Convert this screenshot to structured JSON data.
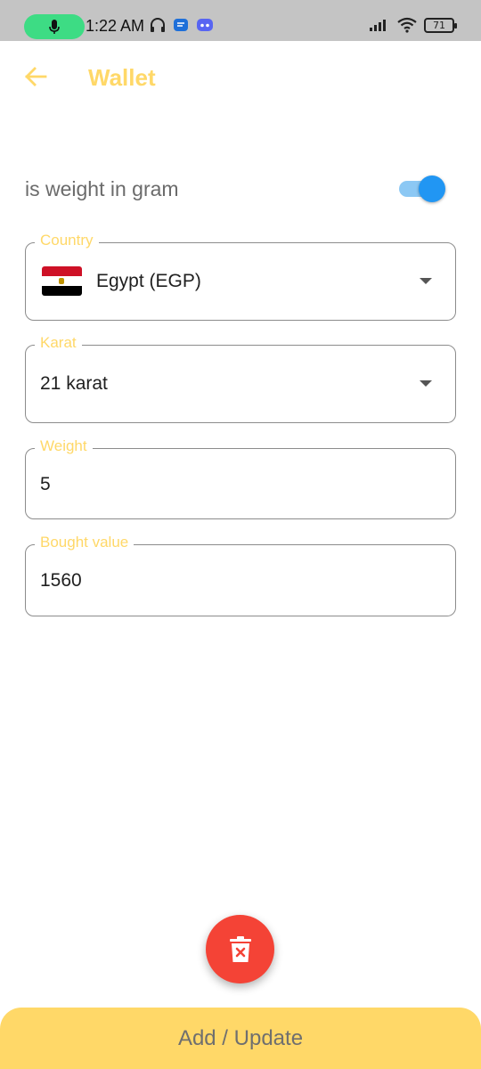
{
  "status_bar": {
    "time": "1:22 AM",
    "battery": "71",
    "icons_left": [
      "mic-icon",
      "headphones-icon",
      "chat-icon",
      "discord-icon"
    ],
    "icons_right": [
      "signal-icon",
      "wifi-icon",
      "battery-icon"
    ]
  },
  "app_bar": {
    "title": "Wallet",
    "back_icon": "arrow-left-icon"
  },
  "toggle": {
    "label": "is weight in gram",
    "enabled": true
  },
  "fields": {
    "country": {
      "label": "Country",
      "value": "Egypt (EGP)",
      "flag_icon": "egypt-flag-icon"
    },
    "karat": {
      "label": "Karat",
      "value": "21 karat"
    },
    "weight": {
      "label": "Weight",
      "value": "5"
    },
    "bought_value": {
      "label": "Bought value",
      "value": "1560"
    }
  },
  "delete_fab": {
    "icon": "trash-x-icon"
  },
  "primary_button": {
    "label": "Add / Update"
  },
  "colors": {
    "accent": "#ffd868",
    "status_bar": "#c4c4c4",
    "toggle_on": "#2196f3",
    "delete": "#f44336",
    "mic_pill": "#3ddc84"
  }
}
